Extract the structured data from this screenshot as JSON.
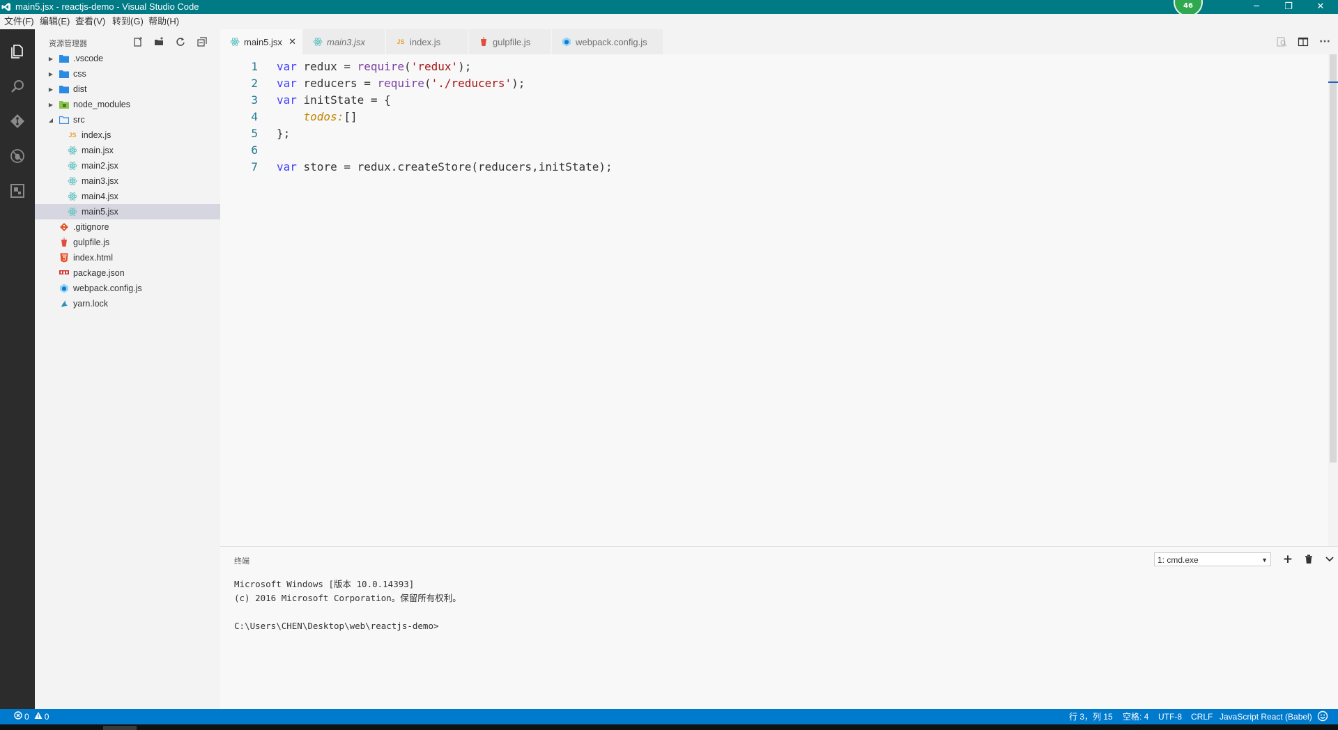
{
  "window": {
    "title": "main5.jsx - reactjs-demo - Visual Studio Code",
    "controls": {
      "minimize": "─",
      "restore": "❐",
      "close": "✕"
    },
    "floating_badge": "46"
  },
  "menu": [
    "文件(F)",
    "编辑(E)",
    "查看(V)",
    "转到(G)",
    "帮助(H)"
  ],
  "activity_bar": [
    "explorer-icon",
    "search-icon",
    "git-icon",
    "debug-icon",
    "extensions-icon"
  ],
  "explorer": {
    "title": "资源管理器",
    "actions": [
      "new-file-icon",
      "new-folder-icon",
      "refresh-icon",
      "collapse-all-icon"
    ],
    "tree": [
      {
        "label": ".vscode",
        "type": "folder",
        "expanded": false,
        "depth": 0,
        "icon": "folder-icon"
      },
      {
        "label": "css",
        "type": "folder",
        "expanded": false,
        "depth": 0,
        "icon": "folder-icon"
      },
      {
        "label": "dist",
        "type": "folder",
        "expanded": false,
        "depth": 0,
        "icon": "folder-icon"
      },
      {
        "label": "node_modules",
        "type": "folder",
        "expanded": false,
        "depth": 0,
        "icon": "node-folder-icon"
      },
      {
        "label": "src",
        "type": "folder",
        "expanded": true,
        "depth": 0,
        "icon": "folder-open-icon"
      },
      {
        "label": "index.js",
        "type": "file",
        "depth": 1,
        "icon": "js-file-icon"
      },
      {
        "label": "main.jsx",
        "type": "file",
        "depth": 1,
        "icon": "react-file-icon"
      },
      {
        "label": "main2.jsx",
        "type": "file",
        "depth": 1,
        "icon": "react-file-icon"
      },
      {
        "label": "main3.jsx",
        "type": "file",
        "depth": 1,
        "icon": "react-file-icon"
      },
      {
        "label": "main4.jsx",
        "type": "file",
        "depth": 1,
        "icon": "react-file-icon"
      },
      {
        "label": "main5.jsx",
        "type": "file",
        "depth": 1,
        "icon": "react-file-icon",
        "selected": true
      },
      {
        "label": ".gitignore",
        "type": "file",
        "depth": 0,
        "icon": "git-file-icon"
      },
      {
        "label": "gulpfile.js",
        "type": "file",
        "depth": 0,
        "icon": "gulp-file-icon"
      },
      {
        "label": "index.html",
        "type": "file",
        "depth": 0,
        "icon": "html-file-icon"
      },
      {
        "label": "package.json",
        "type": "file",
        "depth": 0,
        "icon": "npm-file-icon"
      },
      {
        "label": "webpack.config.js",
        "type": "file",
        "depth": 0,
        "icon": "webpack-file-icon"
      },
      {
        "label": "yarn.lock",
        "type": "file",
        "depth": 0,
        "icon": "yarn-file-icon"
      }
    ]
  },
  "tabs": [
    {
      "label": "main5.jsx",
      "icon": "react-file-icon",
      "active": true,
      "close": "✕"
    },
    {
      "label": "main3.jsx",
      "icon": "react-file-icon",
      "italic": true
    },
    {
      "label": "index.js",
      "icon": "js-file-icon"
    },
    {
      "label": "gulpfile.js",
      "icon": "gulp-file-icon"
    },
    {
      "label": "webpack.config.js",
      "icon": "webpack-file-icon"
    }
  ],
  "editor_actions": [
    "open-preview-icon",
    "split-editor-icon",
    "more-actions-icon"
  ],
  "editor": {
    "lines": [
      {
        "n": "1",
        "tokens": [
          [
            "kw",
            "var"
          ],
          [
            "t",
            " redux = "
          ],
          [
            "call",
            "require"
          ],
          [
            "t",
            "("
          ],
          [
            "str",
            "'redux'"
          ],
          [
            "t",
            ");"
          ]
        ]
      },
      {
        "n": "2",
        "tokens": [
          [
            "kw",
            "var"
          ],
          [
            "t",
            " reducers = "
          ],
          [
            "call",
            "require"
          ],
          [
            "t",
            "("
          ],
          [
            "str",
            "'./reducers'"
          ],
          [
            "t",
            ");"
          ]
        ]
      },
      {
        "n": "3",
        "tokens": [
          [
            "kw",
            "var"
          ],
          [
            "t",
            " initState = {"
          ]
        ]
      },
      {
        "n": "4",
        "tokens": [
          [
            "t",
            "    "
          ],
          [
            "prop",
            "todos:"
          ],
          [
            "t",
            "[]"
          ]
        ]
      },
      {
        "n": "5",
        "tokens": [
          [
            "t",
            "};"
          ]
        ]
      },
      {
        "n": "6",
        "tokens": []
      },
      {
        "n": "7",
        "tokens": [
          [
            "kw",
            "var"
          ],
          [
            "t",
            " store = redux.createStore(reducers,initState);"
          ]
        ]
      }
    ]
  },
  "panel": {
    "title": "终端",
    "terminal_select": "1: cmd.exe",
    "actions": {
      "add": "+",
      "kill": "🗑",
      "collapse": "⌄"
    },
    "lines": [
      "Microsoft Windows [版本 10.0.14393]",
      "(c) 2016 Microsoft Corporation。保留所有权利。",
      "",
      "C:\\Users\\CHEN\\Desktop\\web\\reactjs-demo>"
    ]
  },
  "statusbar": {
    "errors": "0",
    "warnings": "0",
    "position": "行 3，列 15",
    "indent": "空格: 4",
    "encoding": "UTF-8",
    "eol": "CRLF",
    "language": "JavaScript React (Babel)",
    "feedback_icon": "smiley-icon"
  },
  "colors": {
    "titlebar": "#007a85",
    "statusbar": "#007acc",
    "activitybar": "#2c2c2c",
    "sidebar": "#f3f3f3",
    "editor_bg": "#f8f8f8",
    "selection": "#d6d6e0"
  }
}
